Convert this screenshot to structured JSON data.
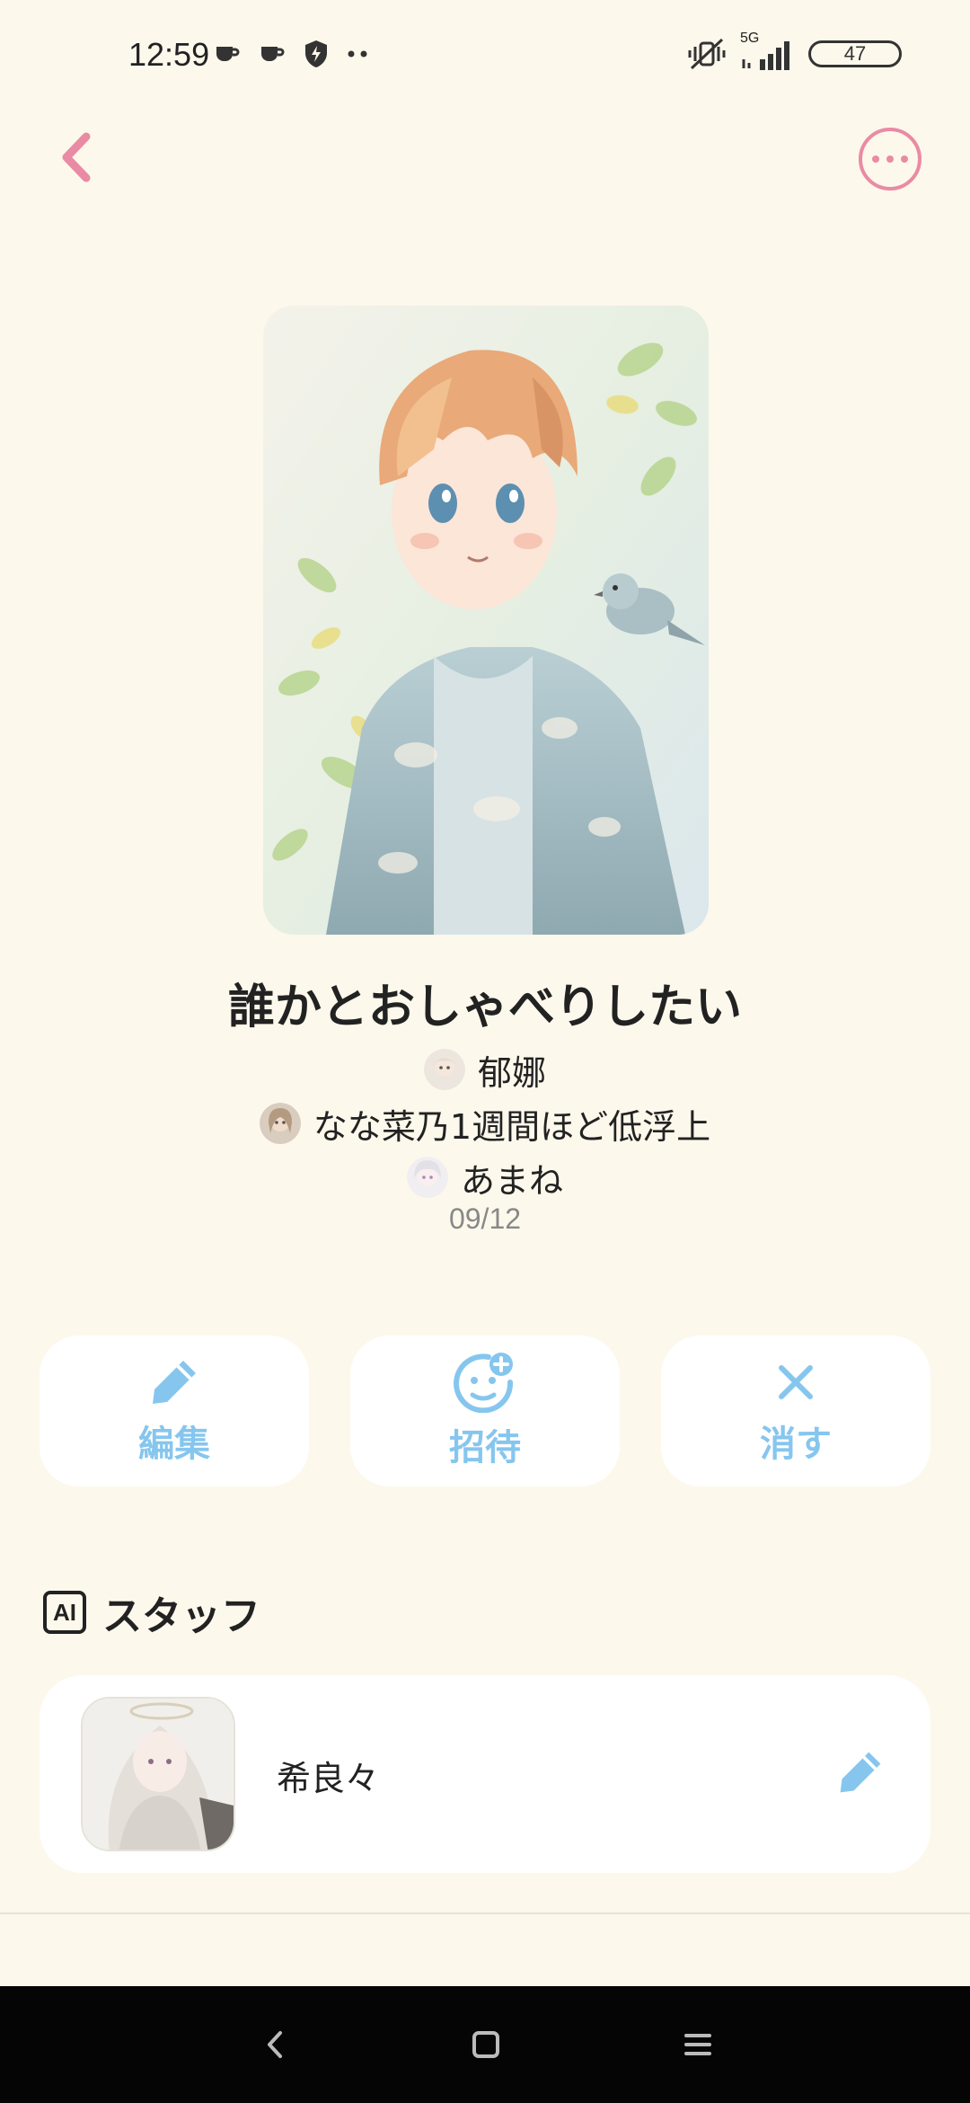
{
  "status_bar": {
    "time": "12:59",
    "network": "5G",
    "battery": "47"
  },
  "colors": {
    "background": "#fdf8ec",
    "accent_pink": "#e98ba4",
    "accent_blue": "#86c6ee"
  },
  "header": {
    "back_icon": "chevron-left-icon",
    "more_icon": "more-horizontal-icon"
  },
  "room": {
    "title": "誰かとおしゃべりしたい",
    "members": [
      {
        "name": "郁娜"
      },
      {
        "name": "なな菜乃1週間ほど低浮上"
      },
      {
        "name": "あまね"
      }
    ],
    "date": "09/12"
  },
  "actions": [
    {
      "label": "編集",
      "icon": "pencil-icon"
    },
    {
      "label": "招待",
      "icon": "add-user-icon"
    },
    {
      "label": "消す",
      "icon": "close-icon"
    }
  ],
  "staff": {
    "badge": "AI",
    "section_title": "スタッフ",
    "name": "希良々"
  }
}
